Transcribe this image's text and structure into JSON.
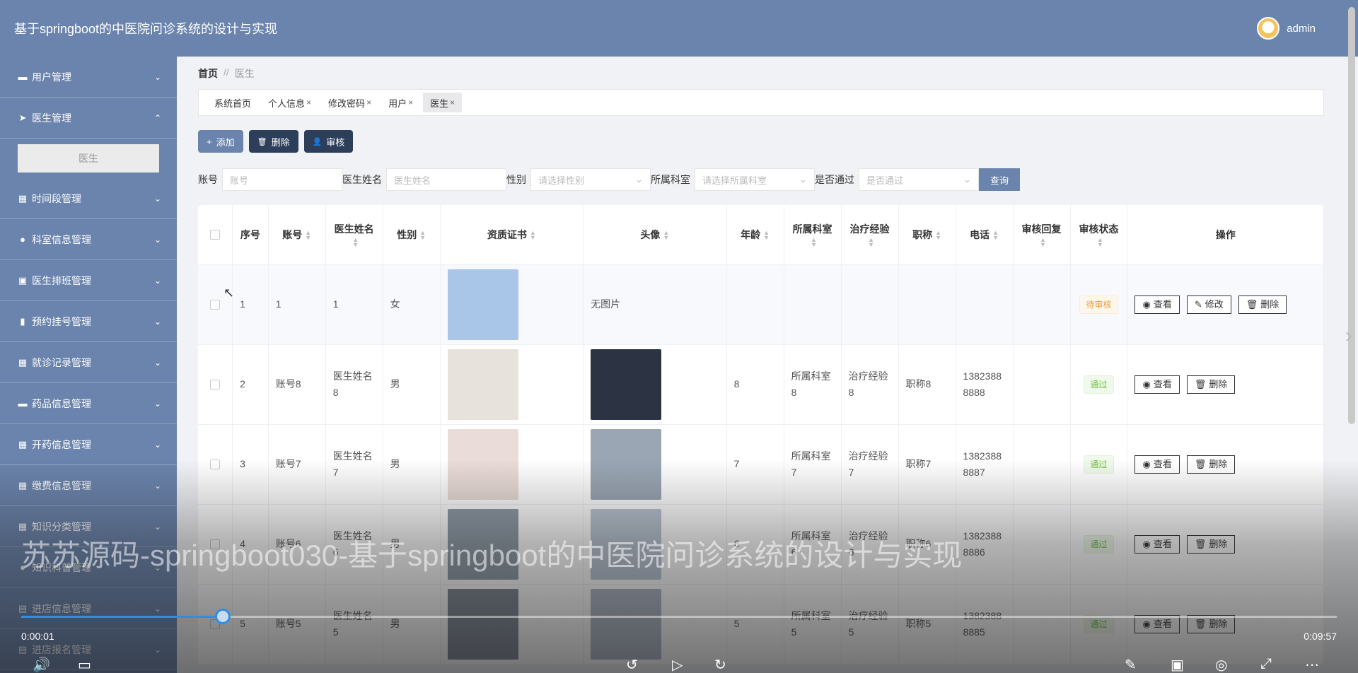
{
  "header": {
    "title": "基于springboot的中医院问诊系统的设计与实现",
    "username": "admin"
  },
  "sidebar": {
    "items": [
      {
        "label": "用户管理",
        "icon": "chat-icon",
        "glyph": "▬",
        "chev": "⌄"
      },
      {
        "label": "医生管理",
        "icon": "send-icon",
        "glyph": "➤",
        "chev": "⌃"
      },
      {
        "label": "时间段管理",
        "icon": "grid-icon",
        "glyph": "▦",
        "chev": "⌄"
      },
      {
        "label": "科室信息管理",
        "icon": "user-icon",
        "glyph": "●",
        "chev": "⌄"
      },
      {
        "label": "医生排班管理",
        "icon": "chart-icon",
        "glyph": "▣",
        "chev": "⌄"
      },
      {
        "label": "预约挂号管理",
        "icon": "bar-chart-icon",
        "glyph": "▮",
        "chev": "⌄"
      },
      {
        "label": "就诊记录管理",
        "icon": "grid-icon",
        "glyph": "▦",
        "chev": "⌄"
      },
      {
        "label": "药品信息管理",
        "icon": "chat-icon",
        "glyph": "▬",
        "chev": "⌄"
      },
      {
        "label": "开药信息管理",
        "icon": "grid-icon",
        "glyph": "▦",
        "chev": "⌄"
      },
      {
        "label": "缴费信息管理",
        "icon": "grid-icon",
        "glyph": "▦",
        "chev": "⌄"
      },
      {
        "label": "知识分类管理",
        "icon": "grid-icon",
        "glyph": "▦",
        "chev": "⌄"
      },
      {
        "label": "知识科普管理",
        "icon": "user-icon",
        "glyph": "●",
        "chev": "⌄"
      },
      {
        "label": "进店信息管理",
        "icon": "document-icon",
        "glyph": "▤",
        "chev": "⌄"
      },
      {
        "label": "进店报名管理",
        "icon": "document-icon",
        "glyph": "▤",
        "chev": "⌄"
      }
    ],
    "submenu": {
      "label": "医生"
    }
  },
  "breadcrumb": {
    "home": "首页",
    "sep": "//",
    "current": "医生"
  },
  "tabs": [
    {
      "label": "系统首页",
      "close": ""
    },
    {
      "label": "个人信息",
      "close": "×"
    },
    {
      "label": "修改密码",
      "close": "×"
    },
    {
      "label": "用户",
      "close": "×"
    },
    {
      "label": "医生",
      "close": "×"
    }
  ],
  "toolbar": {
    "add": "添加",
    "delete": "删除",
    "audit": "审核",
    "add_glyph": "+",
    "delete_glyph": "🗑",
    "audit_glyph": "👤"
  },
  "filters": {
    "account_label": "账号",
    "account_placeholder": "账号",
    "name_label": "医生姓名",
    "name_placeholder": "医生姓名",
    "gender_label": "性别",
    "gender_placeholder": "请选择性别",
    "dept_label": "所属科室",
    "dept_placeholder": "请选择所属科室",
    "passed_label": "是否通过",
    "passed_placeholder": "是否通过",
    "query": "查询"
  },
  "table": {
    "columns": [
      "序号",
      "账号",
      "医生姓名",
      "性别",
      "资质证书",
      "头像",
      "年龄",
      "所属科室",
      "治疗经验",
      "职称",
      "电话",
      "审核回复",
      "审核状态",
      "操作"
    ],
    "rows": [
      {
        "no": "1",
        "account": "1",
        "name": "1",
        "gender": "女",
        "avatar_text": "无图片",
        "age": "",
        "dept": "",
        "exp": "",
        "title": "",
        "phone": "",
        "reply": "",
        "status": "待审核",
        "status_kind": "wait",
        "cert_color": "#a9c6e8",
        "avatar_color": ""
      },
      {
        "no": "2",
        "account": "账号8",
        "name": "医生姓名8",
        "gender": "男",
        "avatar_text": "",
        "age": "8",
        "dept": "所属科室8",
        "exp": "治疗经验8",
        "title": "职称8",
        "phone": "13823888888",
        "reply": "",
        "status": "通过",
        "status_kind": "pass",
        "cert_color": "#e8e2dc",
        "avatar_color": "#2c3342"
      },
      {
        "no": "3",
        "account": "账号7",
        "name": "医生姓名7",
        "gender": "男",
        "avatar_text": "",
        "age": "7",
        "dept": "所属科室7",
        "exp": "治疗经验7",
        "title": "职称7",
        "phone": "13823888887",
        "reply": "",
        "status": "通过",
        "status_kind": "pass",
        "cert_color": "#eadcd8",
        "avatar_color": "#9aa6b4"
      },
      {
        "no": "4",
        "account": "账号6",
        "name": "医生姓名6",
        "gender": "男",
        "avatar_text": "",
        "age": "6",
        "dept": "所属科室6",
        "exp": "治疗经验6",
        "title": "职称6",
        "phone": "13823888886",
        "reply": "",
        "status": "通过",
        "status_kind": "pass",
        "cert_color": "#8e9aa6",
        "avatar_color": "#b9c4d2"
      },
      {
        "no": "5",
        "account": "账号5",
        "name": "医生姓名5",
        "gender": "男",
        "avatar_text": "",
        "age": "5",
        "dept": "所属科室5",
        "exp": "治疗经验5",
        "title": "职称5",
        "phone": "13823888885",
        "reply": "",
        "status": "通过",
        "status_kind": "pass",
        "cert_color": "#7e8794",
        "avatar_color": "#aeb8c6"
      }
    ],
    "actions": {
      "view": "查看",
      "edit": "修改",
      "delete": "删除"
    }
  },
  "video": {
    "watermark": "苏苏源码-springboot030-基于springboot的中医院问诊系统的设计与实现",
    "current_time": "0:00:01",
    "total_time": "0:09:57",
    "progress": 0.153
  }
}
